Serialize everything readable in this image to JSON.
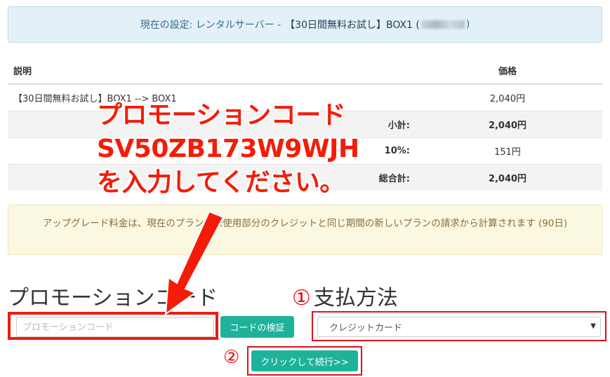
{
  "settings": {
    "prefix": "現在の設定: レンタルサーバー - ",
    "plan": "【30日間無料お試し】BOX1 (",
    "suffix": ")"
  },
  "table": {
    "headers": [
      "説明",
      "価格"
    ],
    "rows": [
      {
        "desc": "【30日間無料お試し】BOX1 --> BOX1",
        "price": "2,040円"
      },
      {
        "label": "小計:",
        "price": "2,040円"
      },
      {
        "label": "10%:",
        "price": "151円"
      },
      {
        "label": "総合計:",
        "price": "2,040円"
      }
    ]
  },
  "notice": "アップグレード料金は、現在のプランの未使用部分のクレジットと同じ期間の新しいプランの請求から計算されます (90日)",
  "promo": {
    "title": "プロモーションコード",
    "placeholder": "プロモーションコード",
    "verify_label": "コードの検証"
  },
  "payment": {
    "number": "①",
    "title": "支払方法",
    "selected": "クレジットカード"
  },
  "continue": {
    "number": "②",
    "label": "クリックして続行>>"
  },
  "overlay": {
    "line1": "プロモーションコード",
    "line2": "SV50ZB173W9WJH",
    "line3": "を入力してください。"
  },
  "colors": {
    "accent": "#1fb29b",
    "annotation_red": "#f41c08"
  }
}
